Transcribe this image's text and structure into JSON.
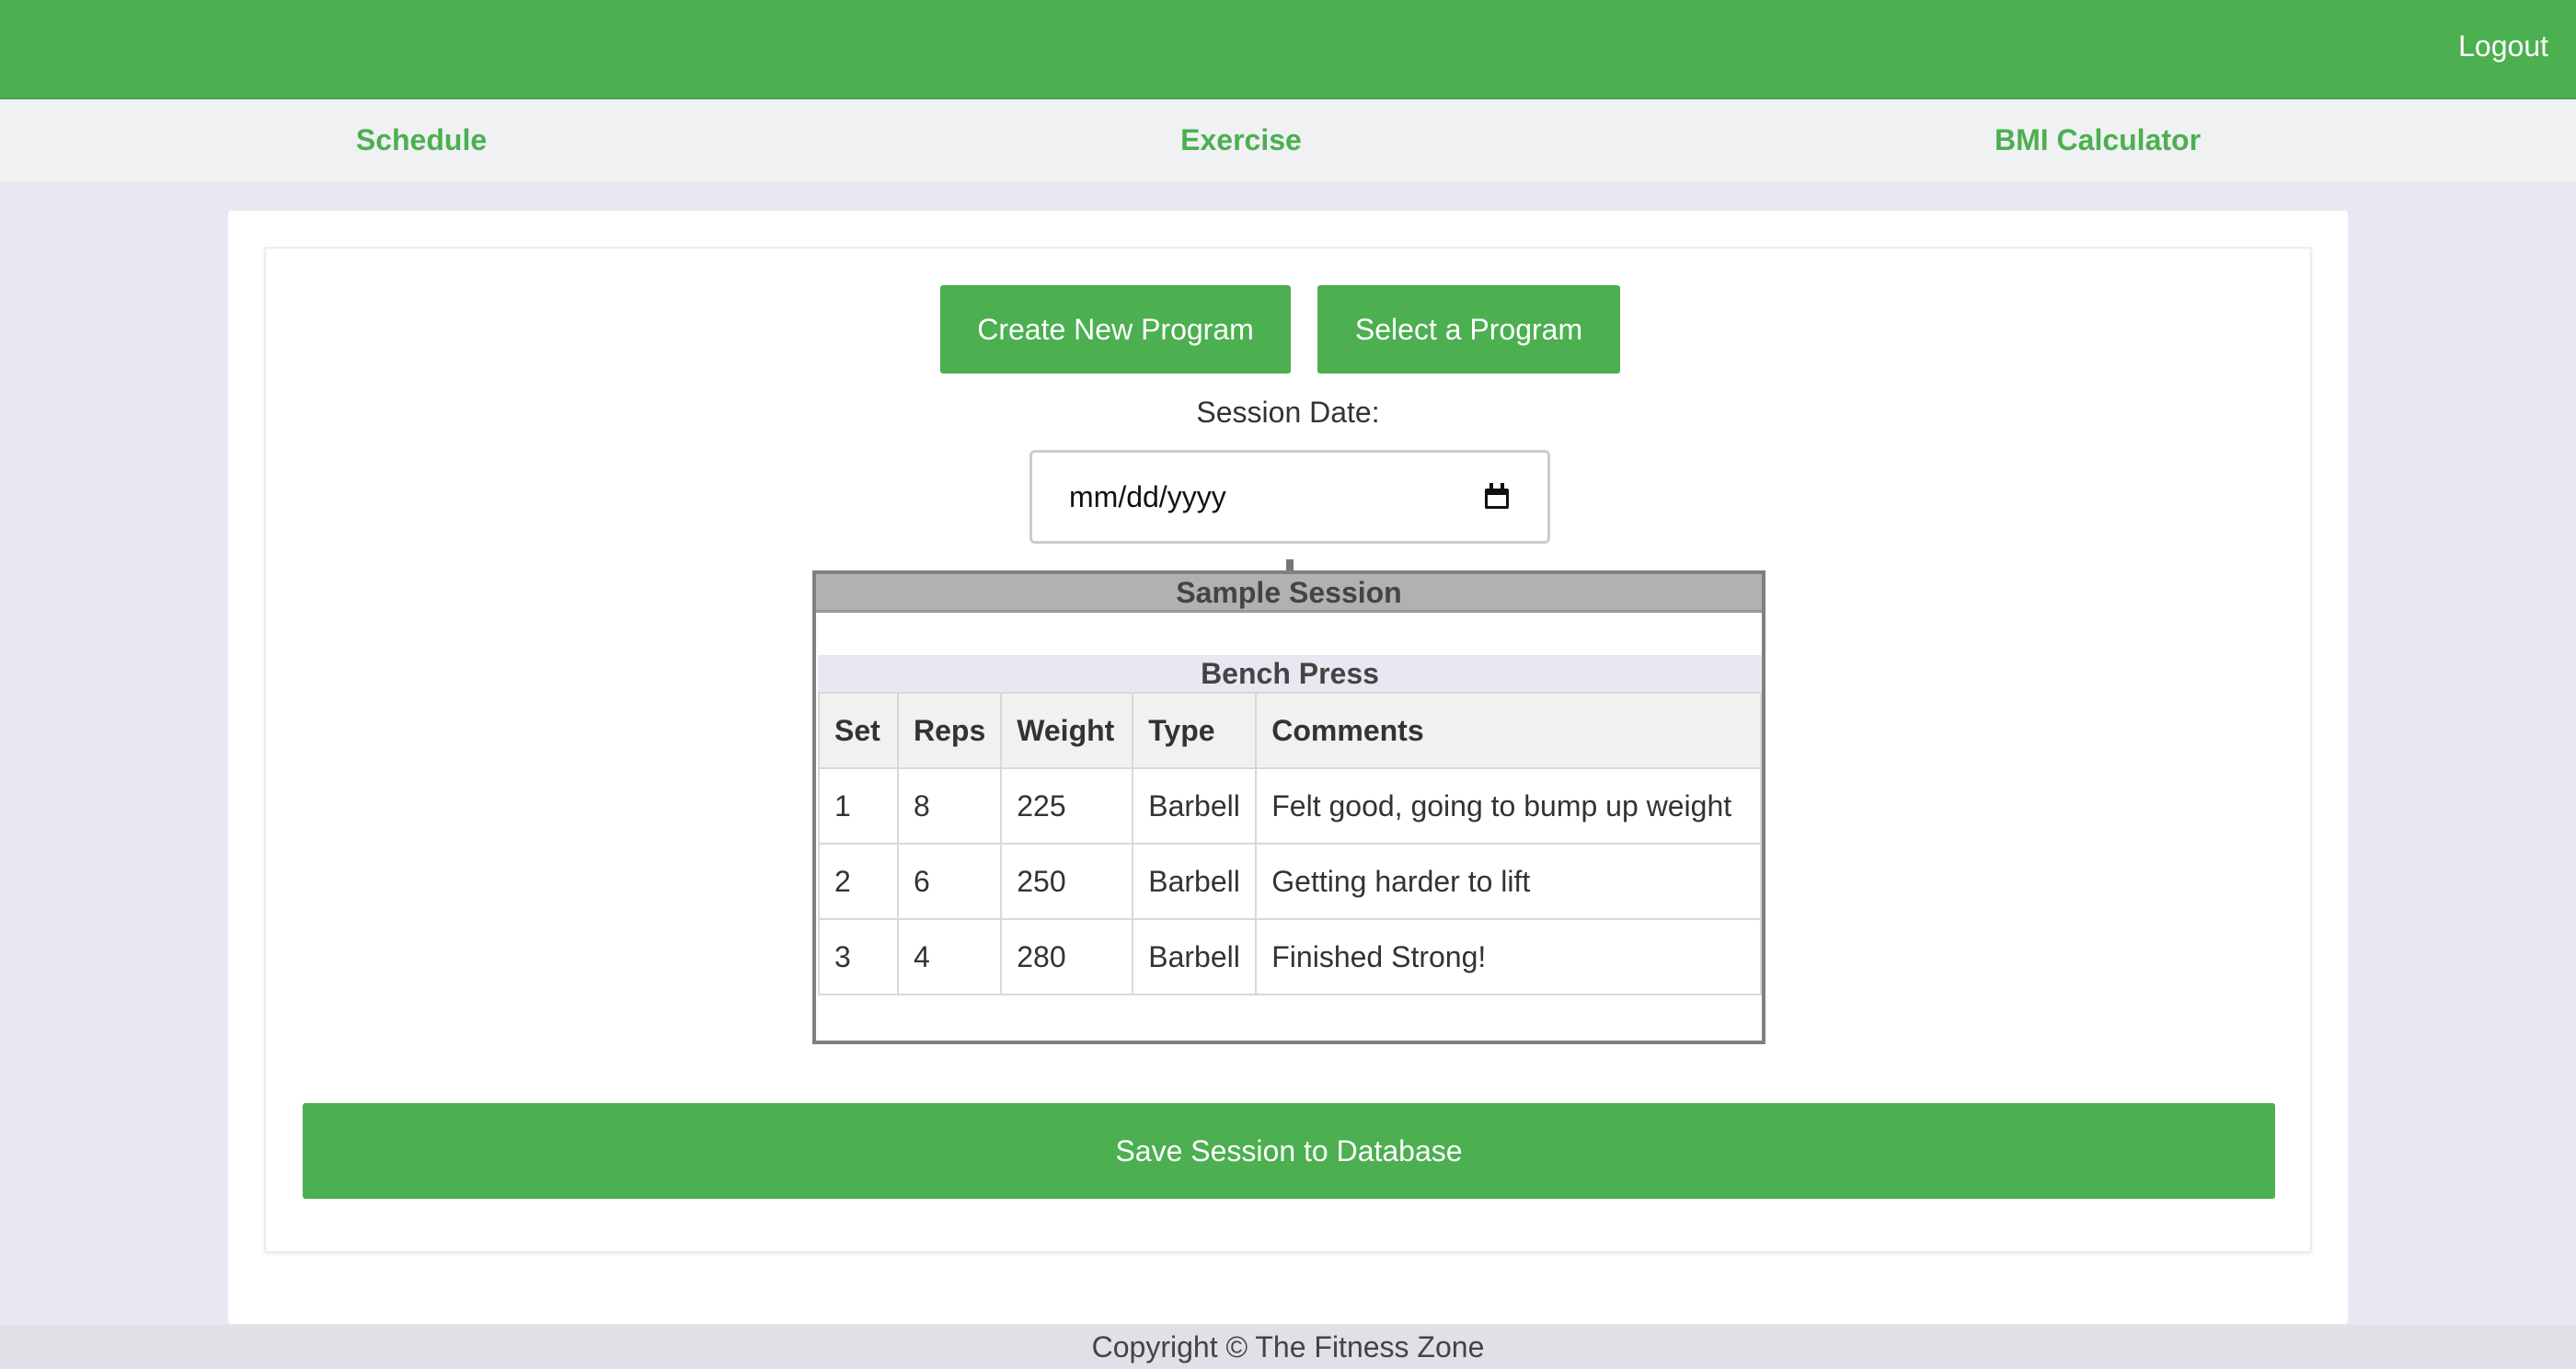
{
  "header": {
    "logout_label": "Logout",
    "accent_color": "#4caf50"
  },
  "nav": {
    "items": [
      {
        "label": "Schedule"
      },
      {
        "label": "Exercise"
      },
      {
        "label": "BMI Calculator"
      }
    ]
  },
  "program": {
    "create_label": "Create New Program",
    "select_label": "Select a Program"
  },
  "session": {
    "date_label": "Session Date:",
    "date_placeholder": "mm/dd/yyyy",
    "title": "Sample Session",
    "exercise": {
      "name": "Bench Press",
      "columns": [
        "Set",
        "Reps",
        "Weight",
        "Type",
        "Comments"
      ],
      "rows": [
        [
          "1",
          "8",
          "225",
          "Barbell",
          "Felt good, going to bump up weight"
        ],
        [
          "2",
          "6",
          "250",
          "Barbell",
          "Getting harder to lift"
        ],
        [
          "3",
          "4",
          "280",
          "Barbell",
          "Finished Strong!"
        ]
      ]
    },
    "save_label": "Save Session to Database"
  },
  "footer": {
    "text": "Copyright © The Fitness Zone"
  }
}
